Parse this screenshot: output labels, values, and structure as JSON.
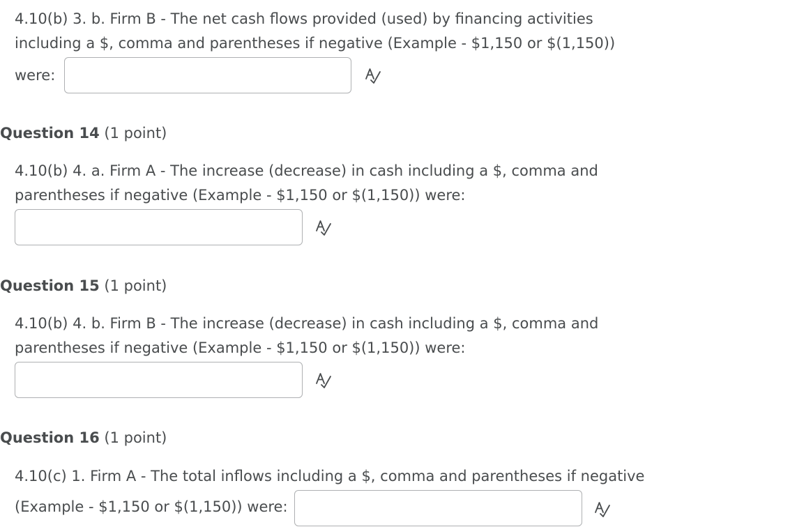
{
  "q13": {
    "line1": "4.10(b) 3. b. Firm B - The net cash flows provided (used) by financing activities",
    "line2": "including a $, comma and parentheses if negative (Example - $1,150 or $(1,150))",
    "line3": "were:",
    "input_value": ""
  },
  "q14": {
    "number": "Question 14",
    "points": "(1 point)",
    "line1": "4.10(b) 4. a. Firm A - The increase (decrease) in cash including a $, comma and",
    "line2": "parentheses if negative (Example - $1,150 or $(1,150)) were:",
    "input_value": ""
  },
  "q15": {
    "number": "Question 15",
    "points": "(1 point)",
    "line1": "4.10(b) 4. b. Firm B - The increase (decrease) in cash including a $, comma and",
    "line2": "parentheses if negative (Example - $1,150 or $(1,150)) were:",
    "input_value": ""
  },
  "q16": {
    "number": "Question 16",
    "points": "(1 point)",
    "line1": "4.10(c) 1. Firm A - The total inflows including a $, comma and parentheses if negative",
    "line2": "(Example - $1,150 or $(1,150)) were:",
    "input_value": ""
  },
  "icons": {
    "spellcheck": "spellcheck-icon"
  }
}
